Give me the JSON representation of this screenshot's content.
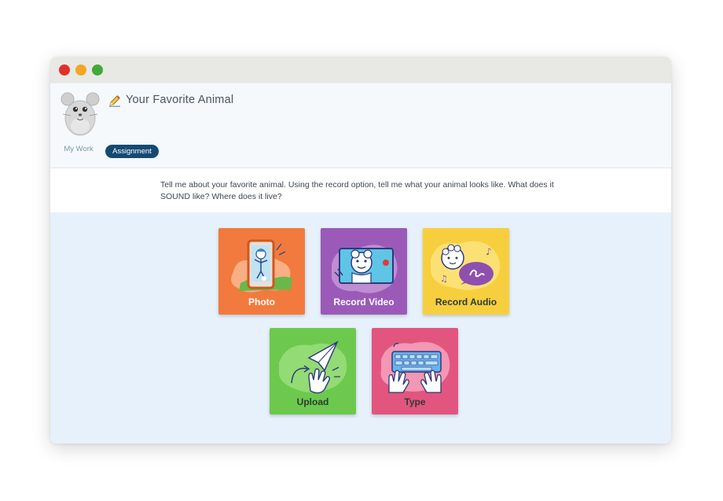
{
  "window": {
    "controls": [
      "close",
      "minimize",
      "maximize"
    ]
  },
  "header": {
    "avatar_icon": "mouse-avatar-icon",
    "title_icon": "pencil-icon",
    "title": "Your Favorite Animal",
    "tabs": {
      "my_work": "My Work",
      "assignment": "Assignment"
    },
    "active_tab": "assignment"
  },
  "prompt": {
    "text": "Tell me about your favorite animal.  Using the record option, tell me what your animal looks like.  What does it SOUND like?  Where does it live?"
  },
  "options": [
    {
      "id": "photo",
      "label": "Photo",
      "icon": "camera-phone-icon",
      "color": "#f27a3e"
    },
    {
      "id": "video",
      "label": "Record Video",
      "icon": "video-camera-icon",
      "color": "#9b5ab8"
    },
    {
      "id": "audio",
      "label": "Record Audio",
      "icon": "microphone-icon",
      "color": "#f7cf3e"
    },
    {
      "id": "upload",
      "label": "Upload",
      "icon": "paper-plane-icon",
      "color": "#6cc94e"
    },
    {
      "id": "type",
      "label": "Type",
      "icon": "keyboard-icon",
      "color": "#e2557f"
    }
  ],
  "colors": {
    "assignment_tab": "#144a72",
    "content_background": "#e6f1fb"
  }
}
